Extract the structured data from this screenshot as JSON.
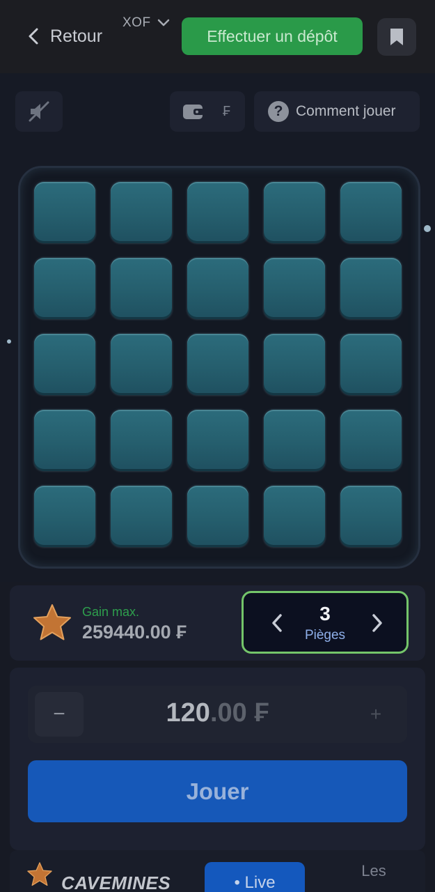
{
  "header": {
    "back_label": "Retour",
    "currency": "XOF",
    "deposit_label": "Effectuer un dépôt"
  },
  "toolbar": {
    "wallet_currency": "₣",
    "howto_label": "Comment jouer",
    "howto_icon_glyph": "?"
  },
  "board": {
    "rows": 5,
    "cols": 5
  },
  "info": {
    "gain_label": "Gain max.",
    "gain_value": "259440.00 ₣",
    "traps_count": "3",
    "traps_label": "Pièges"
  },
  "bet": {
    "minus_label": "−",
    "plus_label": "+",
    "amount_int": "120",
    "amount_dec": ".00 ₣",
    "play_label": "Jouer"
  },
  "bottom": {
    "brand": "CAVEMINES",
    "live_tab": "• Live",
    "other_tab": "Les"
  },
  "colors": {
    "deposit": "#2a9a49",
    "play": "#1658b8",
    "traps_border": "#74c56a",
    "gain_label": "#2e9f4d",
    "tile": "#2c6c7c"
  },
  "icons": {
    "back": "chevron-left-icon",
    "currency_dropdown": "chevron-down-icon",
    "bookmark": "bookmark-icon",
    "sound": "sound-muted-icon",
    "wallet": "wallet-icon",
    "help": "question-icon",
    "gain": "star-icon",
    "traps_prev": "chevron-left-icon",
    "traps_next": "chevron-right-icon"
  }
}
